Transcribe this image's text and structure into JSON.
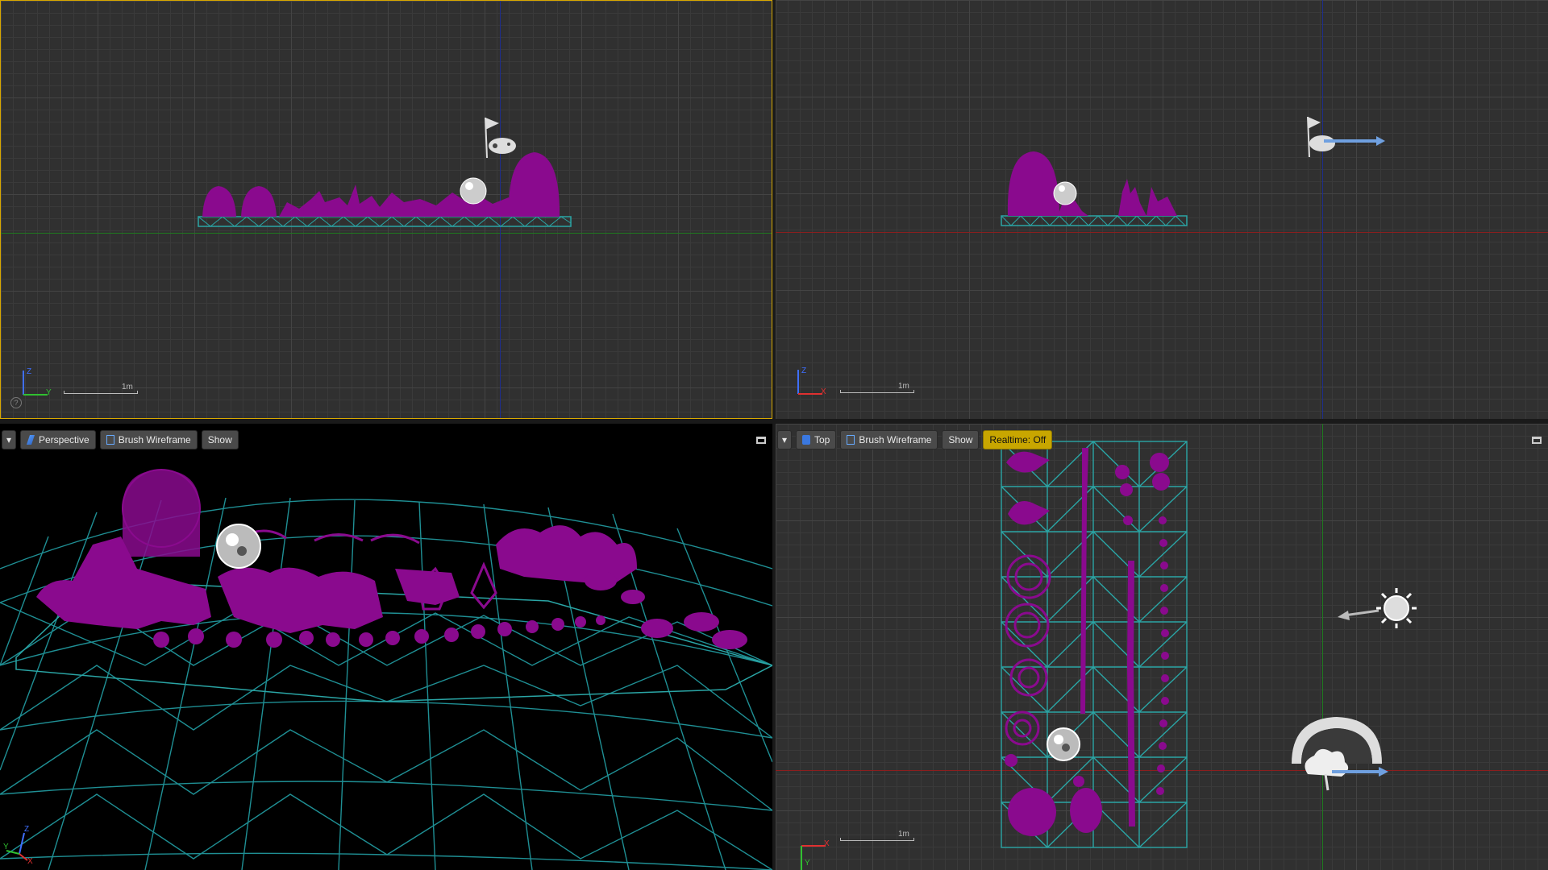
{
  "viewports": {
    "top_left": {
      "scale_label": "1m",
      "gizmo": {
        "up_label": "Z",
        "right_label": "Y"
      },
      "help_icon": "?"
    },
    "top_right": {
      "scale_label": "1m",
      "gizmo": {
        "up_label": "Z",
        "right_label": "X"
      }
    },
    "bottom_left": {
      "toolbar": {
        "dropdown_icon": "chevron-down-icon",
        "view_label": "Perspective",
        "view_icon": "perspective-icon",
        "mode_label": "Brush Wireframe",
        "mode_icon": "wireframe-icon",
        "show_label": "Show"
      },
      "gizmo": {
        "up_label": "Z",
        "right_label": "X",
        "depth_label": "Y"
      }
    },
    "bottom_right": {
      "toolbar": {
        "dropdown_icon": "chevron-down-icon",
        "view_label": "Top",
        "view_icon": "top-view-icon",
        "mode_label": "Brush Wireframe",
        "mode_icon": "wireframe-icon",
        "show_label": "Show",
        "realtime_label": "Realtime: Off"
      },
      "scale_label": "1m",
      "gizmo": {
        "up_label": "Y",
        "right_label": "X"
      }
    }
  },
  "colors": {
    "mesh_magenta": "#8a0a8e",
    "wireframe_cyan": "#2aa5a5",
    "active_border": "#d8a800",
    "realtime_badge": "#c8a600",
    "axis_red": "#8b1e1e",
    "axis_green": "#1f7a1f",
    "axis_blue": "#1e2e8b"
  }
}
